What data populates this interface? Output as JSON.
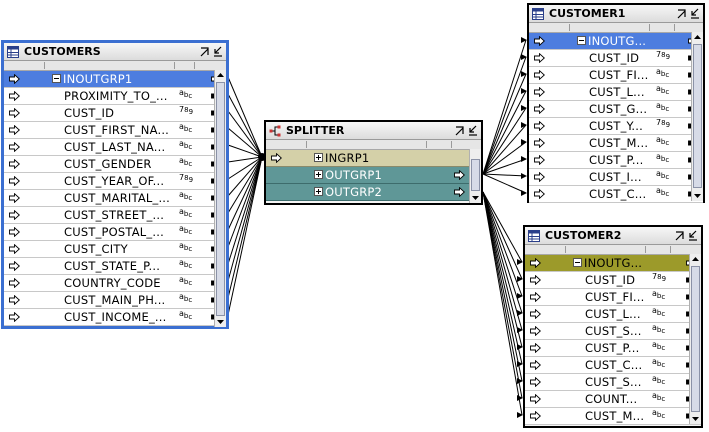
{
  "colors": {
    "selection_border": "#3b6fd1",
    "group_row_highlight": "#4d7ddf",
    "splitter_input_group": "#d4d0a8",
    "splitter_output_group": "#5f9797",
    "customer2_group": "#9c9a2a"
  },
  "customers": {
    "title": "CUSTOMERS",
    "group_label": "INOUTGRP1",
    "attributes": [
      {
        "name": "PROXIMITY_TO_...",
        "type": "abc"
      },
      {
        "name": "CUST_ID",
        "type": "789"
      },
      {
        "name": "CUST_FIRST_NA...",
        "type": "abc"
      },
      {
        "name": "CUST_LAST_NA...",
        "type": "abc"
      },
      {
        "name": "CUST_GENDER",
        "type": "abc"
      },
      {
        "name": "CUST_YEAR_OF...",
        "type": "789"
      },
      {
        "name": "CUST_MARITAL_...",
        "type": "abc"
      },
      {
        "name": "CUST_STREET_...",
        "type": "abc"
      },
      {
        "name": "CUST_POSTAL_...",
        "type": "abc"
      },
      {
        "name": "CUST_CITY",
        "type": "abc"
      },
      {
        "name": "CUST_STATE_P...",
        "type": "abc"
      },
      {
        "name": "COUNTRY_CODE",
        "type": "abc"
      },
      {
        "name": "CUST_MAIN_PH...",
        "type": "abc"
      },
      {
        "name": "CUST_INCOME_...",
        "type": "abc"
      }
    ]
  },
  "splitter": {
    "title": "SPLITTER",
    "groups": [
      {
        "label": "INGRP1"
      },
      {
        "label": "OUTGRP1"
      },
      {
        "label": "OUTGRP2"
      }
    ]
  },
  "customer1": {
    "title": "CUSTOMER1",
    "group_label": "INOUTG...",
    "attributes": [
      {
        "name": "CUST_ID",
        "type": "789"
      },
      {
        "name": "CUST_FI...",
        "type": "abc"
      },
      {
        "name": "CUST_L...",
        "type": "abc"
      },
      {
        "name": "CUST_G...",
        "type": "abc"
      },
      {
        "name": "CUST_Y...",
        "type": "789"
      },
      {
        "name": "CUST_M...",
        "type": "abc"
      },
      {
        "name": "CUST_P...",
        "type": "abc"
      },
      {
        "name": "CUST_I...",
        "type": "abc"
      },
      {
        "name": "CUST_C...",
        "type": "abc"
      }
    ]
  },
  "customer2": {
    "title": "CUSTOMER2",
    "group_label": "INOUTG...",
    "attributes": [
      {
        "name": "CUST_ID",
        "type": "789"
      },
      {
        "name": "CUST_FI...",
        "type": "abc"
      },
      {
        "name": "CUST_L...",
        "type": "abc"
      },
      {
        "name": "CUST_S...",
        "type": "abc"
      },
      {
        "name": "CUST_P...",
        "type": "abc"
      },
      {
        "name": "CUST_C...",
        "type": "abc"
      },
      {
        "name": "CUST_S...",
        "type": "abc"
      },
      {
        "name": "COUNT...",
        "type": "abc"
      },
      {
        "name": "CUST_M...",
        "type": "abc"
      }
    ]
  }
}
